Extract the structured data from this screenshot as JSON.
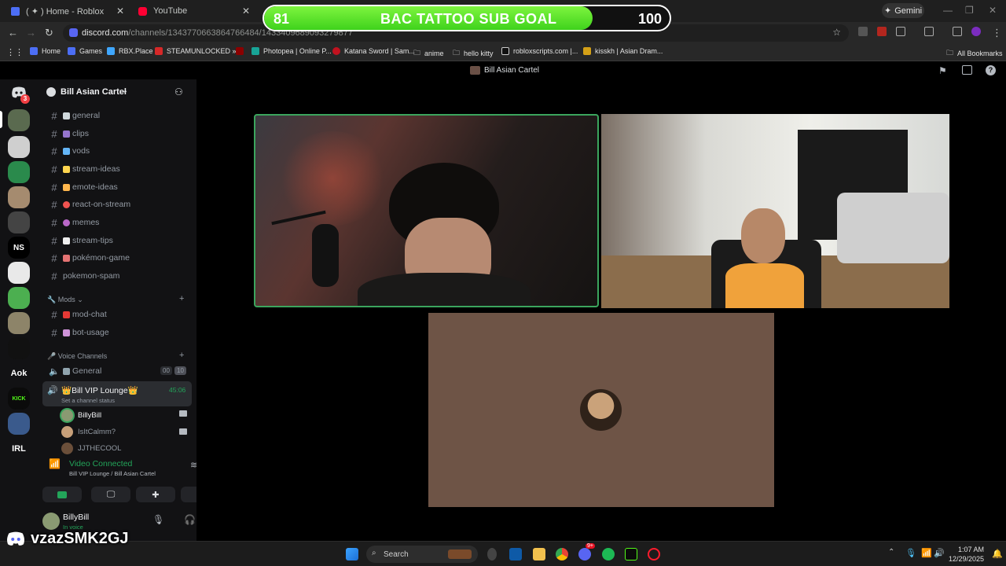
{
  "browser": {
    "tabs": [
      {
        "title": "( ✦ ) Home - Roblox"
      },
      {
        "title": "YouTube"
      }
    ],
    "gemini_label": "Gemini",
    "url_host": "discord.com",
    "url_path": "/channels/1343770663864766484/1433409689093279877",
    "bookmarks": [
      "Home",
      "Games",
      "RBX.Place",
      "STEAMUNLOCKED »...",
      "Photopea | Online P...",
      "Katana Sword | Sam...",
      "anime",
      "hello kitty",
      "robloxscripts.com |...",
      "kisskh | Asian Dram..."
    ],
    "all_bookmarks": "All Bookmarks"
  },
  "sub_goal": {
    "current": "81",
    "title": "BAC TATTOO SUB GOAL",
    "target": "100",
    "progress_fraction": 0.81
  },
  "discord": {
    "window_title": "Bill Asian Cartel",
    "rail_badge": "3",
    "rail_labels": {
      "ns": "NS",
      "aok": "Aok",
      "irl": "IRL",
      "kick": "KICK"
    },
    "server_name": "Bill Asian Cartel",
    "channels": [
      {
        "name": "general"
      },
      {
        "name": "clips"
      },
      {
        "name": "vods"
      },
      {
        "name": "stream-ideas"
      },
      {
        "name": "emote-ideas"
      },
      {
        "name": "react-on-stream"
      },
      {
        "name": "memes"
      },
      {
        "name": "stream-tips"
      },
      {
        "name": "pokémon-game"
      },
      {
        "name": "pokemon-spam"
      }
    ],
    "mods_category": "Mods",
    "mod_channels": [
      {
        "name": "mod-chat"
      },
      {
        "name": "bot-usage"
      }
    ],
    "voice_category": "Voice Channels",
    "voice_general": {
      "name": "General",
      "count_a": "00",
      "count_b": "10"
    },
    "voice_vip": {
      "name": "Bill VIP Lounge",
      "timer": "45:06",
      "status_hint": "Set a channel status"
    },
    "voice_users": [
      "BillyBill",
      "IsItCalmm?",
      "JJTHECOOL"
    ],
    "connection": {
      "status": "Video Connected",
      "location": "Bill VIP Lounge / Bill Asian Cartel"
    },
    "user": {
      "name": "BillyBill",
      "status": "In voice"
    }
  },
  "watermark": "vzazSMK2GJ",
  "taskbar": {
    "search_placeholder": "Search",
    "time": "1:07 AM",
    "date": "12/29/2025",
    "discord_badge": "9+"
  },
  "colors": {
    "discord_blurple": "#5865f2",
    "goal_green": "#4ade26",
    "speaking_green": "#3ba55d",
    "voice_green": "#23a55a"
  }
}
